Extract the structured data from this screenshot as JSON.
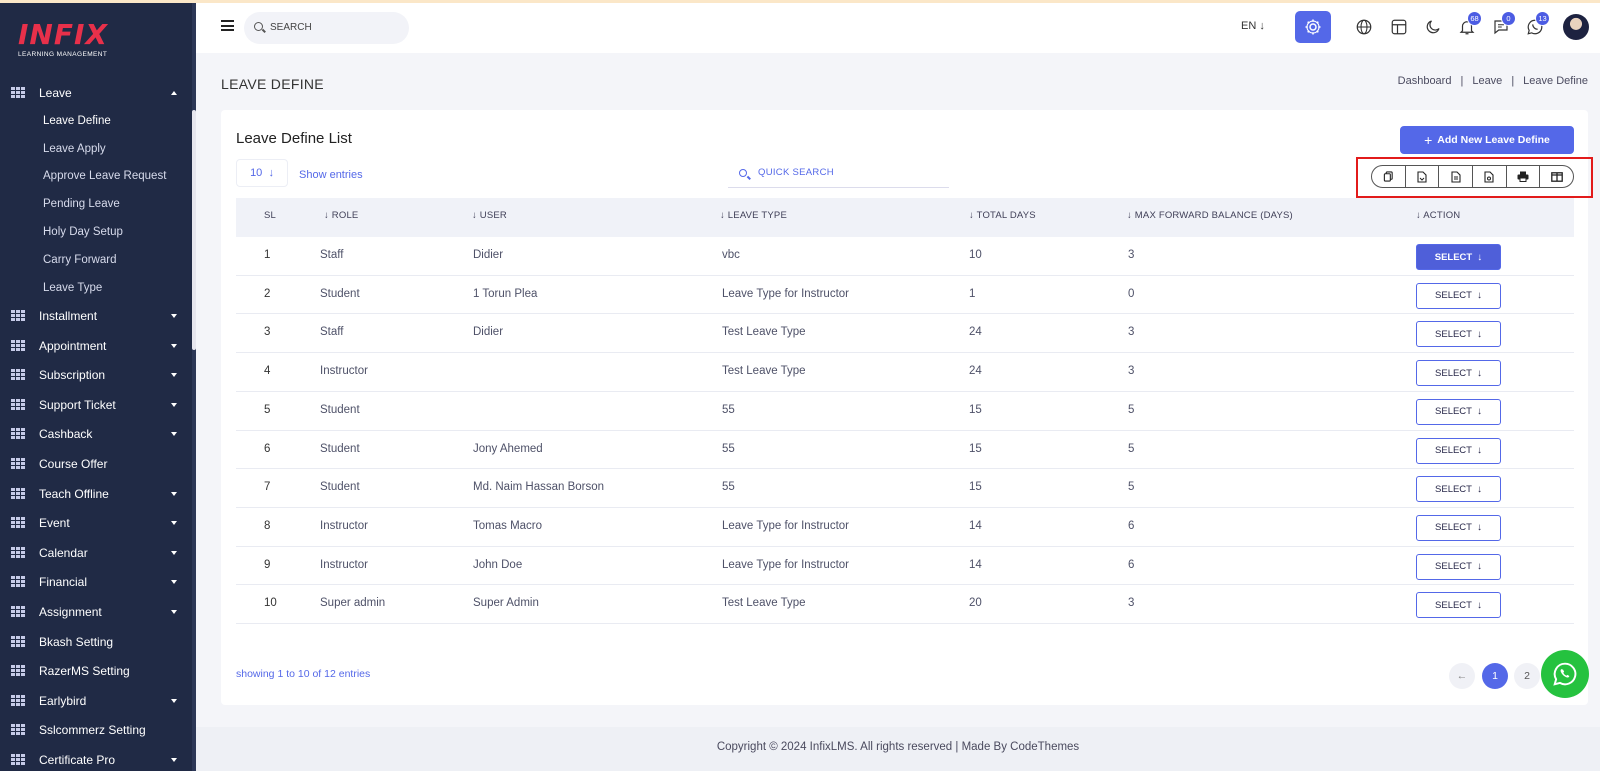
{
  "brand": {
    "logo_text": "INFIX",
    "logo_sub": "LEARNING MANAGEMENT"
  },
  "sidebar": {
    "menus": [
      {
        "label": "Leave",
        "expanded": true
      },
      {
        "label": "Installment"
      },
      {
        "label": "Appointment"
      },
      {
        "label": "Subscription"
      },
      {
        "label": "Support Ticket"
      },
      {
        "label": "Cashback"
      },
      {
        "label": "Course Offer"
      },
      {
        "label": "Teach Offline"
      },
      {
        "label": "Event"
      },
      {
        "label": "Calendar"
      },
      {
        "label": "Financial"
      },
      {
        "label": "Assignment"
      },
      {
        "label": "Bkash Setting"
      },
      {
        "label": "RazerMS Setting"
      },
      {
        "label": "Earlybird"
      },
      {
        "label": "Sslcommerz Setting"
      },
      {
        "label": "Certificate Pro"
      }
    ],
    "leave_submenu": [
      "Leave Define",
      "Leave Apply",
      "Approve Leave Request",
      "Pending Leave",
      "Holy Day Setup",
      "Carry Forward",
      "Leave Type"
    ]
  },
  "header": {
    "search_placeholder": "SEARCH",
    "language": "EN",
    "badges": {
      "notifications": "68",
      "messages": "0",
      "whatsapp": "13"
    }
  },
  "page": {
    "title": "LEAVE DEFINE",
    "breadcrumb": [
      "Dashboard",
      "Leave",
      "Leave Define"
    ]
  },
  "card": {
    "title": "Leave Define List",
    "add_button": "Add New Leave Define",
    "entries_value": "10",
    "entries_label": "Show entries",
    "quick_search_placeholder": "QUICK SEARCH",
    "export_buttons": [
      "copy-icon",
      "csv-icon",
      "excel-icon",
      "pdf-icon",
      "print-icon",
      "columns-icon"
    ]
  },
  "table": {
    "headers": [
      "SL",
      "ROLE",
      "USER",
      "LEAVE TYPE",
      "TOTAL DAYS",
      "MAX FORWARD BALANCE (DAYS)",
      "ACTION"
    ],
    "rows": [
      {
        "sl": "1",
        "role": "Staff",
        "user": "Didier",
        "leave_type": "vbc",
        "total_days": "10",
        "max_forward": "3",
        "action": "SELECT"
      },
      {
        "sl": "2",
        "role": "Student",
        "user": "1 Torun Plea",
        "leave_type": "Leave Type for Instructor",
        "total_days": "1",
        "max_forward": "0",
        "action": "SELECT"
      },
      {
        "sl": "3",
        "role": "Staff",
        "user": "Didier",
        "leave_type": "Test Leave Type",
        "total_days": "24",
        "max_forward": "3",
        "action": "SELECT"
      },
      {
        "sl": "4",
        "role": "Instructor",
        "user": "",
        "leave_type": "Test Leave Type",
        "total_days": "24",
        "max_forward": "3",
        "action": "SELECT"
      },
      {
        "sl": "5",
        "role": "Student",
        "user": "",
        "leave_type": "55",
        "total_days": "15",
        "max_forward": "5",
        "action": "SELECT"
      },
      {
        "sl": "6",
        "role": "Student",
        "user": "Jony Ahemed",
        "leave_type": "55",
        "total_days": "15",
        "max_forward": "5",
        "action": "SELECT"
      },
      {
        "sl": "7",
        "role": "Student",
        "user": "Md. Naim Hassan Borson",
        "leave_type": "55",
        "total_days": "15",
        "max_forward": "5",
        "action": "SELECT"
      },
      {
        "sl": "8",
        "role": "Instructor",
        "user": "Tomas Macro",
        "leave_type": "Leave Type for Instructor",
        "total_days": "14",
        "max_forward": "6",
        "action": "SELECT"
      },
      {
        "sl": "9",
        "role": "Instructor",
        "user": "John Doe",
        "leave_type": "Leave Type for Instructor",
        "total_days": "14",
        "max_forward": "6",
        "action": "SELECT"
      },
      {
        "sl": "10",
        "role": "Super admin",
        "user": "Super Admin",
        "leave_type": "Test Leave Type",
        "total_days": "20",
        "max_forward": "3",
        "action": "SELECT"
      }
    ]
  },
  "pagination": {
    "summary": "showing 1 to 10 of 12 entries",
    "pages": [
      "1",
      "2"
    ],
    "current": "1"
  },
  "footer": {
    "text": "Copyright © 2024 InfixLMS. All rights reserved | Made By CodeThemes"
  },
  "colors": {
    "sidebar_bg": "#202a45",
    "accent": "#5468e8",
    "highlight_box": "#e21b1b",
    "whatsapp": "#25c23f"
  }
}
